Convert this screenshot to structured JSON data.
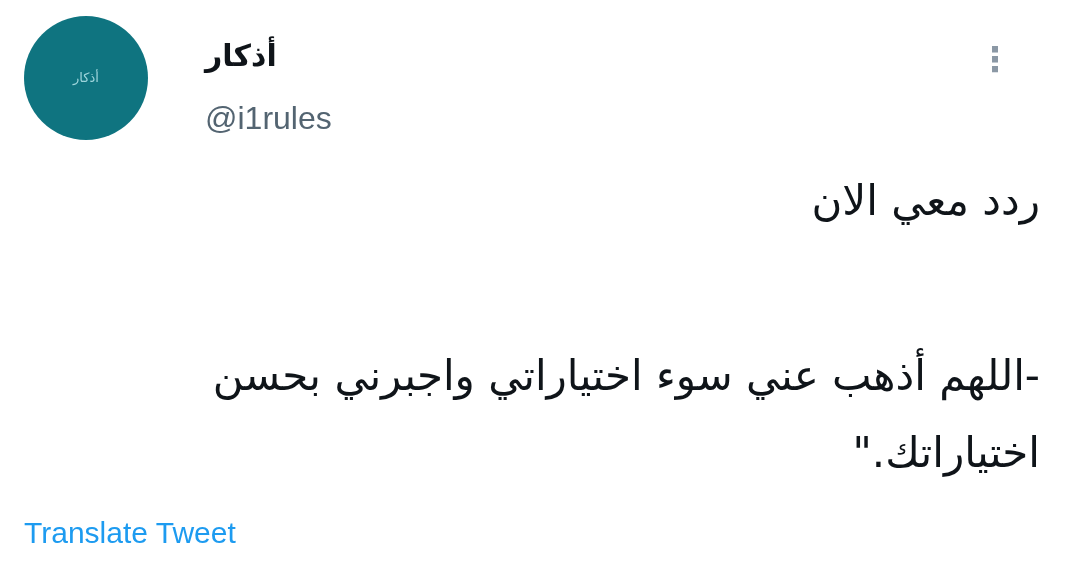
{
  "author": {
    "avatar_text": "أذكار",
    "name": "أذكار",
    "handle": "@i1rules"
  },
  "more_menu": {
    "icon": "⋮"
  },
  "tweet": {
    "paragraphs": [
      "ردد معي الان",
      "-اللهم أذهب عني سوء اختياراتي واجبرني بحسن اختياراتك.\""
    ]
  },
  "translate_link": "Translate Tweet"
}
